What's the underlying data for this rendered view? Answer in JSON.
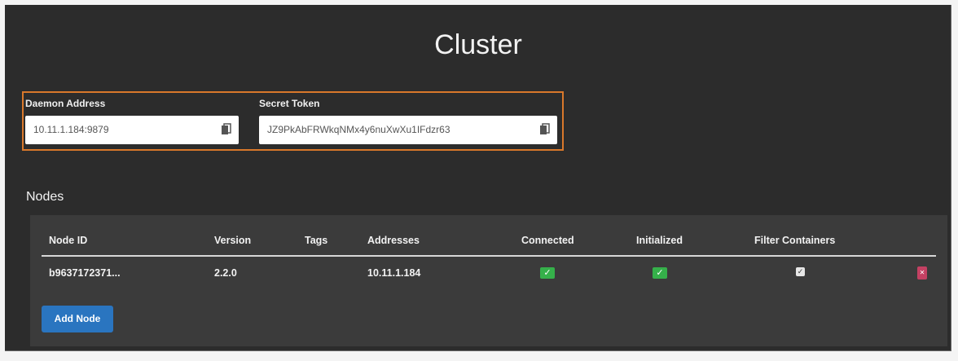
{
  "page": {
    "title": "Cluster"
  },
  "credentials": {
    "daemon_address_label": "Daemon Address",
    "daemon_address_value": "10.11.1.184:9879",
    "secret_token_label": "Secret Token",
    "secret_token_value": "JZ9PkAbFRWkqNMx4y6nuXwXu1IFdzr63",
    "copy_icon": "clipboard-icon",
    "highlight_color": "#d9782b"
  },
  "nodes": {
    "title": "Nodes",
    "columns": [
      "Node ID",
      "Version",
      "Tags",
      "Addresses",
      "Connected",
      "Initialized",
      "Filter Containers"
    ],
    "rows": [
      {
        "node_id": "b9637172371...",
        "version": "2.2.0",
        "tags": "",
        "addresses": "10.11.1.184",
        "connected": true,
        "initialized": true,
        "filter_containers": true
      }
    ],
    "add_button": "Add Node",
    "colors": {
      "status_ok": "#35b04a",
      "delete": "#c44163",
      "primary": "#2a75c0"
    }
  }
}
